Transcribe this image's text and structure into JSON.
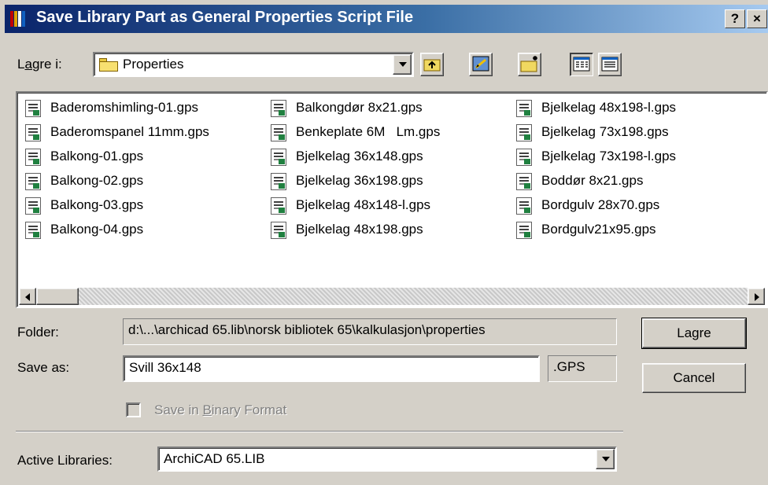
{
  "dialog": {
    "title": "Save Library Part as General Properties Script File",
    "help_label": "?",
    "close_label": "×"
  },
  "location": {
    "label_prefix": "L",
    "label_accel": "a",
    "label_suffix": "gre i:",
    "folder_value": "Properties"
  },
  "toolbar": {
    "icons": [
      "up-one-level-icon",
      "desktop-icon",
      "new-folder-icon",
      "list-view-icon",
      "details-view-icon"
    ]
  },
  "files": {
    "columns": [
      [
        "Baderomshimling-01.gps",
        "Baderomspanel 11mm.gps",
        "Balkong-01.gps",
        "Balkong-02.gps",
        "Balkong-03.gps",
        "Balkong-04.gps"
      ],
      [
        "Balkongdør 8x21.gps",
        "Benkeplate 6M   Lm.gps",
        "Bjelkelag 36x148.gps",
        "Bjelkelag 36x198.gps",
        "Bjelkelag 48x148-l.gps",
        "Bjelkelag 48x198.gps"
      ],
      [
        "Bjelkelag 48x198-l.gps",
        "Bjelkelag 73x198.gps",
        "Bjelkelag 73x198-l.gps",
        "Boddør 8x21.gps",
        "Bordgulv 28x70.gps",
        "Bordgulv21x95.gps"
      ]
    ]
  },
  "folder": {
    "label": "Folder:",
    "value": "d:\\...\\archicad 65.lib\\norsk bibliotek 65\\kalkulasjon\\properties"
  },
  "save_as": {
    "label": "Save as:",
    "value": "Svill 36x148",
    "extension": ".GPS"
  },
  "binary": {
    "label_prefix": "Save in ",
    "label_accel": "B",
    "label_suffix": "inary Format",
    "checked": false
  },
  "buttons": {
    "save_label": "Lagre",
    "cancel_label": "Cancel"
  },
  "libraries": {
    "label": "Active Libraries:",
    "value": "ArchiCAD 65.LIB"
  },
  "colors": {
    "titlebar_start": "#0a246a",
    "titlebar_end": "#a6caf0",
    "face": "#d4d0c8"
  }
}
